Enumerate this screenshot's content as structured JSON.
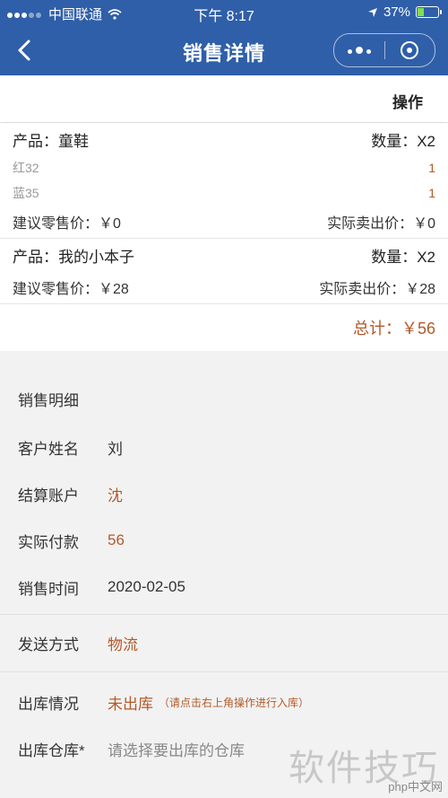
{
  "status": {
    "carrier": "中国联通",
    "time": "下午 8:17",
    "battery": "37%",
    "battery_level": 0.37
  },
  "nav": {
    "title": "销售详情"
  },
  "toolbar": {
    "op_label": "操作"
  },
  "products": [
    {
      "label": "产品：童鞋",
      "qty": "数量：X2",
      "variants": [
        {
          "name": "红32",
          "count": "1"
        },
        {
          "name": "蓝35",
          "count": "1"
        }
      ],
      "retail": "建议零售价：￥0",
      "actual": "实际卖出价：￥0"
    },
    {
      "label": "产品：我的小本子",
      "qty": "数量：X2",
      "variants": [],
      "retail": "建议零售价：￥28",
      "actual": "实际卖出价：￥28"
    }
  ],
  "total": "总计：￥56",
  "details": {
    "header": "销售明细",
    "customer_label": "客户姓名",
    "customer_value": "刘",
    "account_label": "结算账户",
    "account_value": "沈",
    "paid_label": "实际付款",
    "paid_value": "56",
    "time_label": "销售时间",
    "time_value": "2020-02-05"
  },
  "delivery": {
    "label": "发送方式",
    "value": "物流"
  },
  "stock": {
    "status_label": "出库情况",
    "status_value": "未出库",
    "status_hint": "（请点击右上角操作进行入库）",
    "warehouse_label": "出库仓库*",
    "warehouse_placeholder": "请选择要出库的仓库"
  },
  "watermark": {
    "text": "软件技巧",
    "logo": "php中文网"
  },
  "colors": {
    "nav_bg": "#2f5fa8",
    "accent": "#b25a2a"
  }
}
